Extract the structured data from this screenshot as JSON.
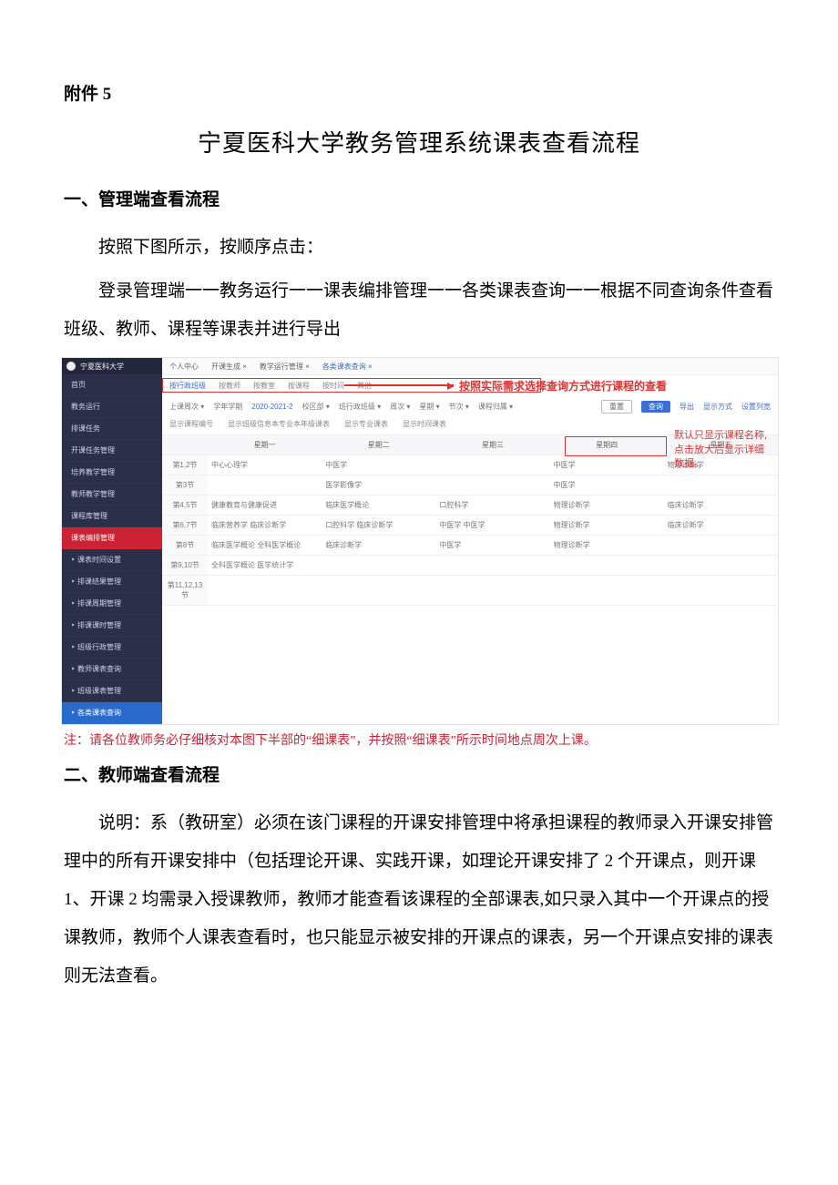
{
  "doc": {
    "attachment": "附件 5",
    "title": "宁夏医科大学教务管理系统课表查看流程",
    "section1_heading": "一、管理端查看流程",
    "section1_p1": "按照下图所示，按顺序点击：",
    "section1_p2": "登录管理端一一教务运行一一课表编排管理一一各类课表查询一一根据不同查询条件查看班级、教师、课程等课表并进行导出",
    "footnote": "注：请各位教师务必仔细核对本图下半部的“细课表”，并按照“细课表”所示时间地点周次上课。",
    "section2_heading": "二、教师端查看流程",
    "section2_p1": "说明：系（教研室）必须在该门课程的开课安排管理中将承担课程的教师录入开课安排管理中的所有开课安排中（包括理论开课、实践开课，如理论开课安排了 2 个开课点，则开课 1、开课 2 均需录入授课教师，教师才能查看该课程的全部课表,如只录入其中一个开课点的授课教师，教师个人课表查看时，也只能显示被安排的开课点的课表，另一个开课点安排的课表则无法查看。"
  },
  "shot": {
    "logo_text": "宁夏医科大学",
    "topbar": {
      "a": "个人中心",
      "b": "开课生成 ×",
      "c": "教学运行管理 ×",
      "d": "各类课表查询 ×"
    },
    "tabs": {
      "t1": "按行政班级",
      "t2": "按教师",
      "t3": "按教室",
      "t4": "按课程",
      "t5": "按时间",
      "t6": "其他"
    },
    "filters": {
      "f1": "上课周次 ▾",
      "f2": "学年学期",
      "f3": "2020-2021-2",
      "f4": "校区部 ▾",
      "f5": "班行政班级 ▾",
      "f6": "周次 ▾",
      "f7": "星期 ▾",
      "f8": "节次 ▾",
      "f9": "课程归属 ▾",
      "btn_reset": "重置",
      "btn_query": "查询",
      "link1": "导出",
      "link2": "显示方式",
      "link3": "设置列宽"
    },
    "filters2": {
      "a": "显示课程编号",
      "b": "显示班级信息本专业本年级课表",
      "c": "显示专业课表",
      "d": "显示时间课表"
    },
    "arrow_text": "按照实际需求选择查询方式进行课程的查看",
    "tip_line1": "默认只显示课程名称,",
    "tip_line2": "点击放大后显示详细",
    "tip_line3": "数据。",
    "sidebar": {
      "items": [
        "首页",
        "教务运行",
        "排课任务",
        "开课任务管理",
        "培养教学管理",
        "教师教学管理",
        "课程库管理",
        "课表编排管理",
        "‣ 课表时间设置",
        "‣ 排课结果管理",
        "‣ 排课周期管理",
        "‣ 排课课时管理",
        "‣ 班级行政管理",
        "‣ 教师课表查询",
        "‣ 班级课表管理",
        "‣ 各类课表查询"
      ]
    },
    "grid": {
      "head": [
        "",
        "星期一",
        "星期二",
        "星期三",
        "星期四",
        "星期五"
      ],
      "rows": [
        {
          "label": "第1,2节",
          "cells": [
            "中心心理学",
            "中医学",
            "",
            "中医学",
            "物理诊断学"
          ]
        },
        {
          "label": "第3节",
          "cells": [
            "",
            "医学影像学",
            "",
            "中医学",
            ""
          ]
        },
        {
          "label": "第4,5节",
          "cells": [
            "健康教育与健康促进",
            "临床医学概论",
            "口腔科学",
            "物理诊断学",
            "临床诊断学"
          ]
        },
        {
          "label": "第6,7节",
          "cells": [
            "临床营养学  临床诊断学",
            "口腔科学 临床诊断学",
            "中医学 中医学",
            "物理诊断学",
            "临床诊断学"
          ]
        },
        {
          "label": "第8节",
          "cells": [
            "临床医学概论 全科医学概论",
            "临床诊断学",
            "中医学",
            "物理诊断学",
            ""
          ]
        },
        {
          "label": "第9,10节",
          "cells": [
            "全科医学概论 医学统计学",
            "",
            "",
            "",
            ""
          ]
        },
        {
          "label": "第11,12,13节",
          "cells": [
            "",
            "",
            "",
            "",
            ""
          ]
        }
      ]
    }
  }
}
